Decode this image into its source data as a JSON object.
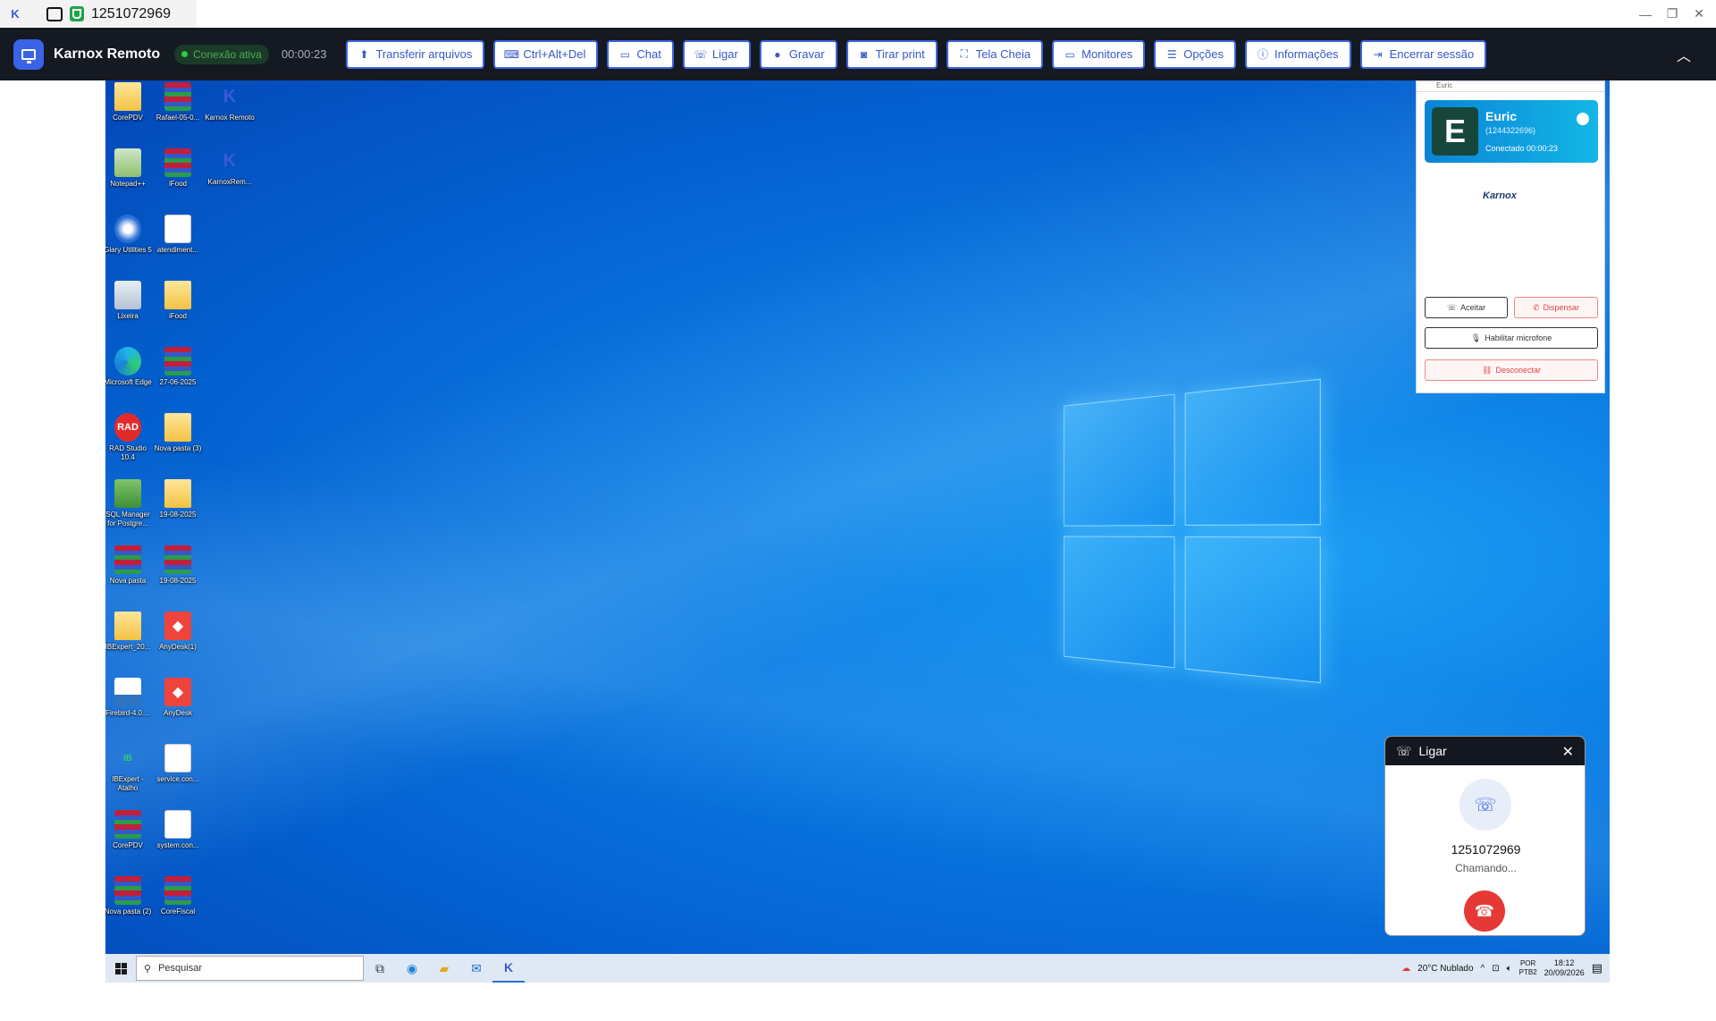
{
  "window": {
    "title": "1251072969",
    "controls": [
      "—",
      "❐",
      "✕"
    ]
  },
  "toolbar": {
    "brand": "Karnox Remoto",
    "status": "Conexão ativa",
    "timer": "00:00:23",
    "buttons": [
      {
        "label": "Transferir arquivos",
        "icon": "file-upload-icon"
      },
      {
        "label": "Ctrl+Alt+Del",
        "icon": "keyboard-icon"
      },
      {
        "label": "Chat",
        "icon": "chat-icon"
      },
      {
        "label": "Ligar",
        "icon": "phone-icon"
      },
      {
        "label": "Gravar",
        "icon": "record-icon"
      },
      {
        "label": "Tirar print",
        "icon": "camera-icon"
      },
      {
        "label": "Tela Cheia",
        "icon": "fullscreen-icon"
      },
      {
        "label": "Monitores",
        "icon": "monitor-icon"
      },
      {
        "label": "Opções",
        "icon": "sliders-icon"
      },
      {
        "label": "Informações",
        "icon": "info-icon"
      },
      {
        "label": "Encerrar sessão",
        "icon": "logout-icon"
      }
    ]
  },
  "desktop_icons": [
    {
      "label": "CorePDV",
      "kind": "folder"
    },
    {
      "label": "Rafael-05-0...",
      "kind": "zip"
    },
    {
      "label": "Karnox Remoto",
      "kind": "k"
    },
    {
      "label": "Notepad++",
      "kind": "notepad"
    },
    {
      "label": "iFood",
      "kind": "zip"
    },
    {
      "label": "KarnoxRem...",
      "kind": "k"
    },
    {
      "label": "Glary Utilities 5",
      "kind": "glary"
    },
    {
      "label": "atendiment...",
      "kind": "file"
    },
    {
      "label": "Lixeira",
      "kind": "bin"
    },
    {
      "label": "iFood",
      "kind": "folder"
    },
    {
      "label": "Microsoft Edge",
      "kind": "edge"
    },
    {
      "label": "27-06-2025",
      "kind": "zip"
    },
    {
      "label": "RAD Studio 10.4",
      "kind": "rad"
    },
    {
      "label": "Nova pasta (3)",
      "kind": "folder"
    },
    {
      "label": "SQL Manager for Postgre...",
      "kind": "sql"
    },
    {
      "label": "19-08-2025",
      "kind": "folder"
    },
    {
      "label": "Nova pasta",
      "kind": "zip"
    },
    {
      "label": "19-08-2025",
      "kind": "zip"
    },
    {
      "label": "IBExpert_20...",
      "kind": "folder"
    },
    {
      "label": "AnyDesk(1)",
      "kind": "anydesk"
    },
    {
      "label": "Firebird-4.0....",
      "kind": "firebird"
    },
    {
      "label": "AnyDesk",
      "kind": "anydesk"
    },
    {
      "label": "IBExpert - Atalho",
      "kind": "ibx"
    },
    {
      "label": "service.con...",
      "kind": "file"
    },
    {
      "label": "CorePDV",
      "kind": "zip"
    },
    {
      "label": "system.con...",
      "kind": "file"
    },
    {
      "label": "Nova pasta (2)",
      "kind": "zip"
    },
    {
      "label": "CoreFiscal",
      "kind": "zip"
    }
  ],
  "taskbar": {
    "search_placeholder": "Pesquisar",
    "weather": "20°C  Nublado",
    "lang_1": "POR",
    "lang_2": "PTB2",
    "time": "18:12",
    "date": "20/09/2026"
  },
  "karnox_panel": {
    "window_title": "Euric",
    "avatar_letter": "E",
    "contact_name": "Euric",
    "contact_id": "(1244322696)",
    "contact_status": "Conectado   00:00:23",
    "brand": "Karnox",
    "accept": "Aceitar",
    "dismiss": "Dispensar",
    "mic": "Habilitar microfone",
    "disconnect": "Desconectar"
  },
  "call_popup": {
    "title": "Ligar",
    "number": "1251072969",
    "status": "Chamando..."
  },
  "colors": {
    "accent": "#3c66e0",
    "toolbar_bg": "#141922",
    "hangup": "#e53935",
    "status_green": "#2ecc40"
  }
}
